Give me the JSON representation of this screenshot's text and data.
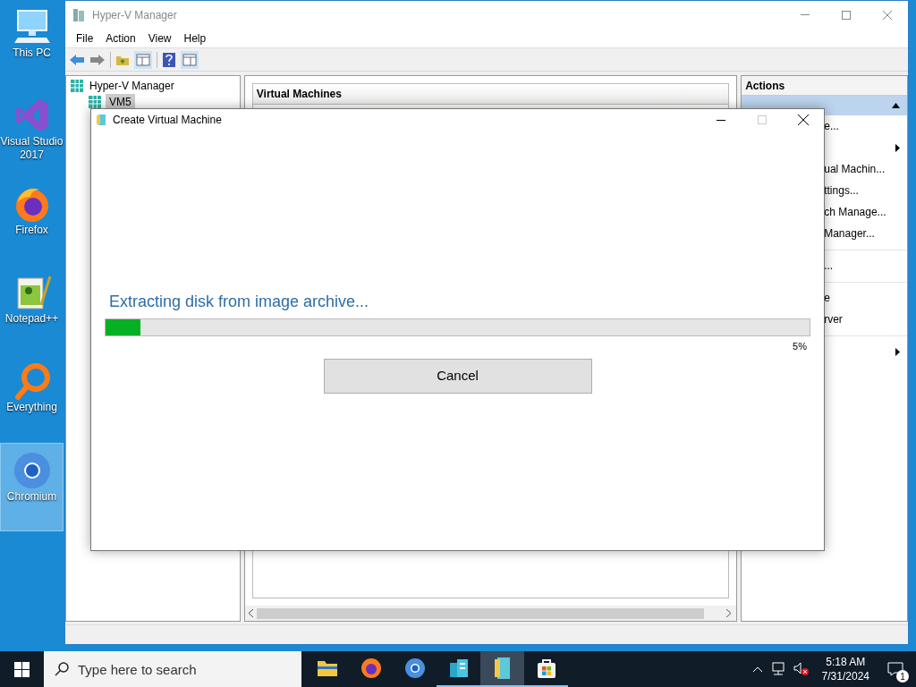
{
  "desktop_icons": [
    {
      "label": "This PC",
      "kind": "pc",
      "selected": false
    },
    {
      "label": "Visual Studio 2017",
      "kind": "vs",
      "selected": false
    },
    {
      "label": "Firefox",
      "kind": "firefox",
      "selected": false
    },
    {
      "label": "Notepad++",
      "kind": "notepad",
      "selected": false
    },
    {
      "label": "Everything",
      "kind": "everything",
      "selected": false
    },
    {
      "label": "Chromium",
      "kind": "chromium",
      "selected": true
    }
  ],
  "manager": {
    "title": "Hyper-V Manager",
    "menu": [
      "File",
      "Action",
      "View",
      "Help"
    ],
    "tree": [
      {
        "label": "Hyper-V Manager",
        "selected": false,
        "children": [
          {
            "label": "VM5",
            "selected": true
          }
        ]
      }
    ],
    "center_header": "Virtual Machines",
    "actions_header": "Actions",
    "actions": [
      {
        "kind": "item",
        "label": "e..."
      },
      {
        "kind": "submenu"
      },
      {
        "kind": "item",
        "label": "ual Machin..."
      },
      {
        "kind": "item",
        "label": "ttings..."
      },
      {
        "kind": "item",
        "label": "ch Manage..."
      },
      {
        "kind": "item",
        "label": "Manager..."
      },
      {
        "kind": "separator"
      },
      {
        "kind": "item",
        "label": "..."
      },
      {
        "kind": "separator"
      },
      {
        "kind": "item",
        "label": "e"
      },
      {
        "kind": "item",
        "label": "rver"
      },
      {
        "kind": "separator"
      },
      {
        "kind": "submenu"
      }
    ]
  },
  "dialog": {
    "title": "Create Virtual Machine",
    "status": "Extracting disk from image archive...",
    "progress": {
      "level": 0.05,
      "reading": "5%"
    },
    "button": "Cancel"
  },
  "taskbar": {
    "search_placeholder": "Type here to search",
    "apps": [
      {
        "kind": "explorer",
        "active": false,
        "running": false
      },
      {
        "kind": "firefox",
        "active": false,
        "running": false
      },
      {
        "kind": "chromium",
        "active": false,
        "running": false
      },
      {
        "kind": "buildings",
        "active": false,
        "running": true
      },
      {
        "kind": "hyperv",
        "active": true,
        "running": true
      },
      {
        "kind": "store",
        "active": false,
        "running": true
      }
    ],
    "time": "5:18 AM",
    "date": "7/31/2024",
    "notifications": "1"
  }
}
